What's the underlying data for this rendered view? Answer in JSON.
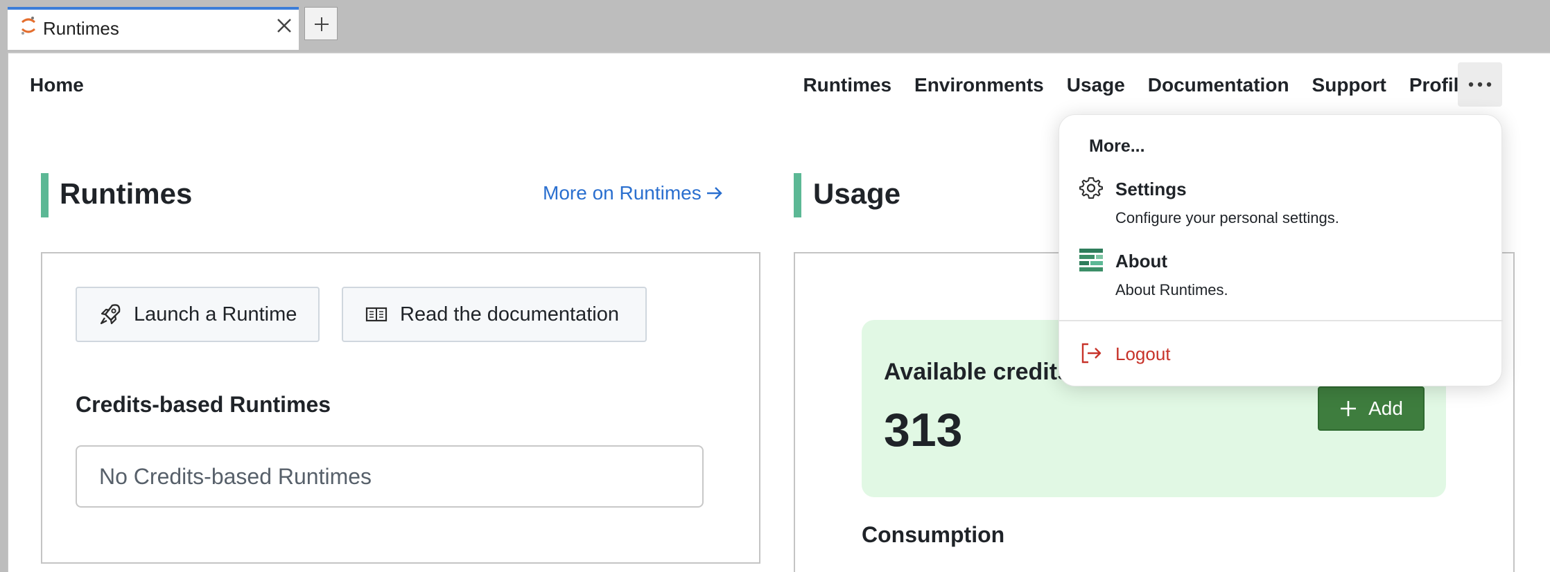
{
  "browser": {
    "tab_title": "Runtimes",
    "new_tab_icon": "plus-icon",
    "close_icon": "close-icon"
  },
  "nav": {
    "home": "Home",
    "links": [
      "Runtimes",
      "Environments",
      "Usage",
      "Documentation",
      "Support",
      "Profile"
    ],
    "more_icon": "ellipsis-icon"
  },
  "runtimes_section": {
    "title": "Runtimes",
    "more_link": "More on Runtimes",
    "launch_button": "Launch a Runtime",
    "docs_button": "Read the documentation",
    "credits_heading": "Credits-based Runtimes",
    "empty_message": "No Credits-based Runtimes"
  },
  "usage_section": {
    "title": "Usage",
    "credits_label": "Available credits",
    "credits_value": "313",
    "add_button": "Add",
    "consumption_heading": "Consumption"
  },
  "menu": {
    "header": "More...",
    "items": [
      {
        "title": "Settings",
        "description": "Configure your personal settings.",
        "icon": "gear-icon"
      },
      {
        "title": "About",
        "description": "About Runtimes.",
        "icon": "app-logo-icon"
      }
    ],
    "logout": "Logout"
  },
  "colors": {
    "accent_bar": "#5cb895",
    "link": "#2a6fcf",
    "credits_bg": "#e1f8e4",
    "add_button": "#3e7d3e",
    "logout": "#c7332a"
  }
}
